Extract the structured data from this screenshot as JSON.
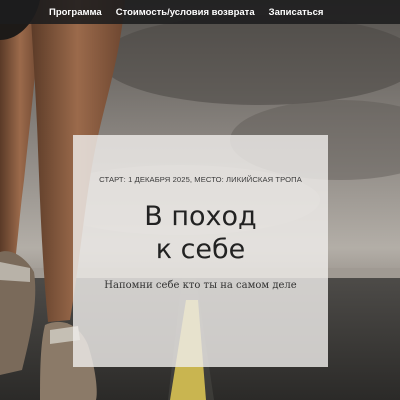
{
  "nav": {
    "items": [
      {
        "label": "Программа"
      },
      {
        "label": "Стоимость/условия возврата"
      },
      {
        "label": "Записаться"
      }
    ]
  },
  "hero": {
    "eyebrow": "СТАРТ: 1 ДЕКАБРЯ 2025, МЕСТО: ЛИКИЙСКАЯ ТРОПА",
    "title_line1": "В поход",
    "title_line2": "к себе",
    "subtitle": "Напомни себе кто ты на самом деле"
  },
  "colors": {
    "nav_bg": "#1c1c1e",
    "card_bg": "#eeece9",
    "title": "#222222"
  }
}
